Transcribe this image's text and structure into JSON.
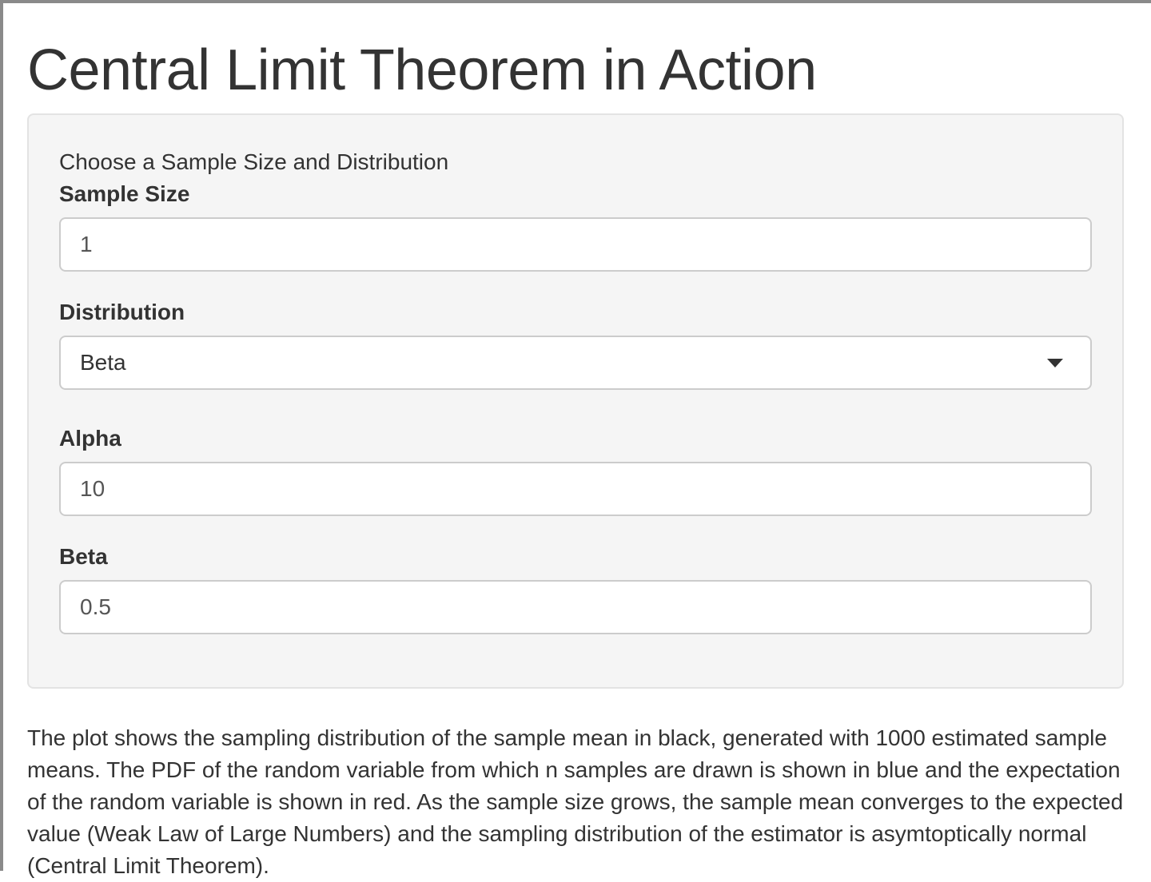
{
  "page": {
    "title": "Central Limit Theorem in Action"
  },
  "panel": {
    "heading": "Choose a Sample Size and Distribution",
    "sample_size": {
      "label": "Sample Size",
      "value": "1"
    },
    "distribution": {
      "label": "Distribution",
      "selected": "Beta"
    },
    "alpha": {
      "label": "Alpha",
      "value": "10"
    },
    "beta": {
      "label": "Beta",
      "value": "0.5"
    }
  },
  "description": {
    "text": "The plot shows the sampling distribution of the sample mean in black, generated with 1000 estimated sample means. The PDF of the random variable from which n samples are drawn is shown in blue and the expectation of the random variable is shown in red. As the sample size grows, the sample mean converges to the expected value (Weak Law of Large Numbers) and the sampling distribution of the estimator is asymtoptically normal (Central Limit Theorem)."
  },
  "icons": {
    "dropdown": "caret-down-icon"
  },
  "colors": {
    "well_background": "#f5f5f5",
    "input_border": "#cccccc",
    "text": "#333333"
  }
}
